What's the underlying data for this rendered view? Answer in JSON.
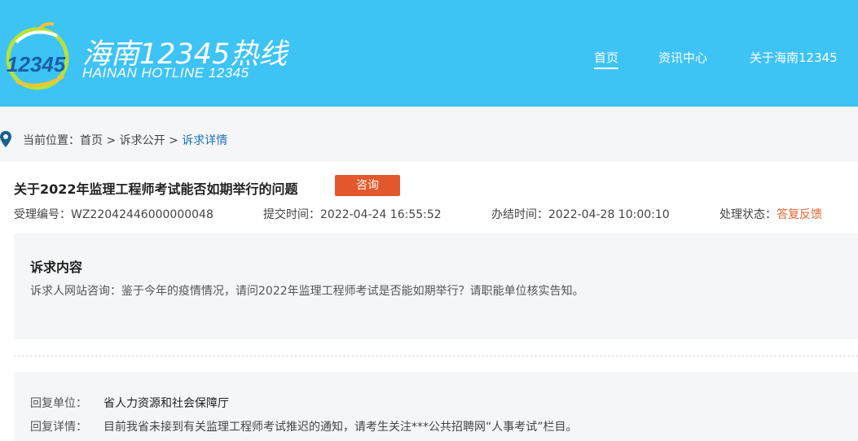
{
  "header": {
    "brand_cn": "海南12345热线",
    "brand_en": "HAINAN HOTLINE 12345",
    "logo_text": "12345",
    "nav": [
      {
        "label": "首页"
      },
      {
        "label": "资讯中心"
      },
      {
        "label": "关于海南12345"
      }
    ]
  },
  "breadcrumb": {
    "prefix": "当前位置：",
    "home": "首页",
    "sep1": " > ",
    "section": "诉求公开",
    "sep2": " > ",
    "current": "诉求详情"
  },
  "case": {
    "title": "关于2022年监理工程师考试能否如期举行的问题",
    "tag": "咨询",
    "id_label": "受理编号：",
    "id_value": "WZ22042446000000048",
    "submit_label": "提交时间：",
    "submit_value": "2022-04-24 16:55:52",
    "finish_label": "办结时间：",
    "finish_value": "2022-04-28 10:00:10",
    "status_label": "处理状态：",
    "status_value": "答复反馈",
    "status_color": "#e2652f",
    "tag_color": "#e2572b"
  },
  "request": {
    "title": "诉求内容",
    "text": "诉求人网站咨询：鉴于今年的疫情情况，请问2022年监理工程师考试是否能如期举行？请职能单位核实告知。"
  },
  "reply": {
    "unit_label": "回复单位：",
    "unit_value": "省人力资源和社会保障厅",
    "detail_label": "回复详情：",
    "detail_value": "目前我省未接到有关监理工程师考试推迟的通知，请考生关注***公共招聘网“人事考试”栏目。"
  },
  "colors": {
    "header_bg": "#3ec3f5",
    "link": "#1d6fb8"
  }
}
